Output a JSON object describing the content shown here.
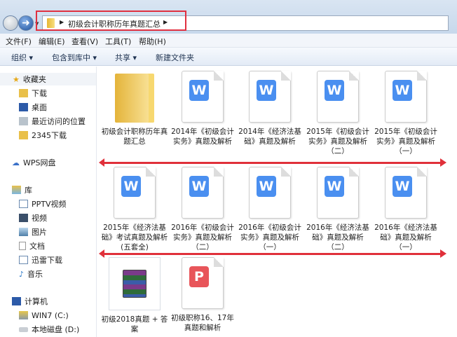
{
  "address": {
    "path": "初级会计职称历年真题汇总"
  },
  "menu": [
    "文件(F)",
    "编辑(E)",
    "查看(V)",
    "工具(T)",
    "帮助(H)"
  ],
  "toolbar": [
    "组织 ▾",
    "包含到库中 ▾",
    "共享 ▾",
    "新建文件夹"
  ],
  "sidebar": {
    "favorites": "收藏夹",
    "fav_items": [
      "下载",
      "桌面",
      "最近访问的位置",
      "2345下载"
    ],
    "wps": "WPS网盘",
    "library": "库",
    "lib_items": [
      "PPTV视频",
      "视频",
      "图片",
      "文档",
      "迅雷下载",
      "音乐"
    ],
    "computer": "计算机",
    "drives": [
      "WIN7 (C:)",
      "本地磁盘 (D:)"
    ]
  },
  "files": [
    {
      "type": "folder",
      "name": "初级会计职称历年真题汇总"
    },
    {
      "type": "wps",
      "name": "2014年《初级会计实务》真题及解析"
    },
    {
      "type": "wps",
      "name": "2014年《经济法基础》真题及解析"
    },
    {
      "type": "wps",
      "name": "2015年《初级会计实务》真题及解析（二）"
    },
    {
      "type": "wps",
      "name": "2015年《初级会计实务》真题及解析（一）"
    },
    {
      "type": "wps",
      "name": "2015年《经济法基础》考试真题及解析(五套全)"
    },
    {
      "type": "wps",
      "name": "2016年《初级会计实务》真题及解析（二）"
    },
    {
      "type": "wps",
      "name": "2016年《初级会计实务》真题及解析（一）"
    },
    {
      "type": "wps",
      "name": "2016年《经济法基础》真题及解析（二）"
    },
    {
      "type": "wps",
      "name": "2016年《经济法基础》真题及解析（一）"
    },
    {
      "type": "rar",
      "name": "初级2018真题 + 答案"
    },
    {
      "type": "pdf",
      "name": "初级职称16、17年真题和解析"
    }
  ],
  "icons": {
    "wps_letter": "W",
    "pdf_letter": "P"
  },
  "colors": {
    "wps": "#4a8ff0",
    "pdf": "#e8555a",
    "arrow": "#e0303a",
    "highlight": "#e03040"
  }
}
